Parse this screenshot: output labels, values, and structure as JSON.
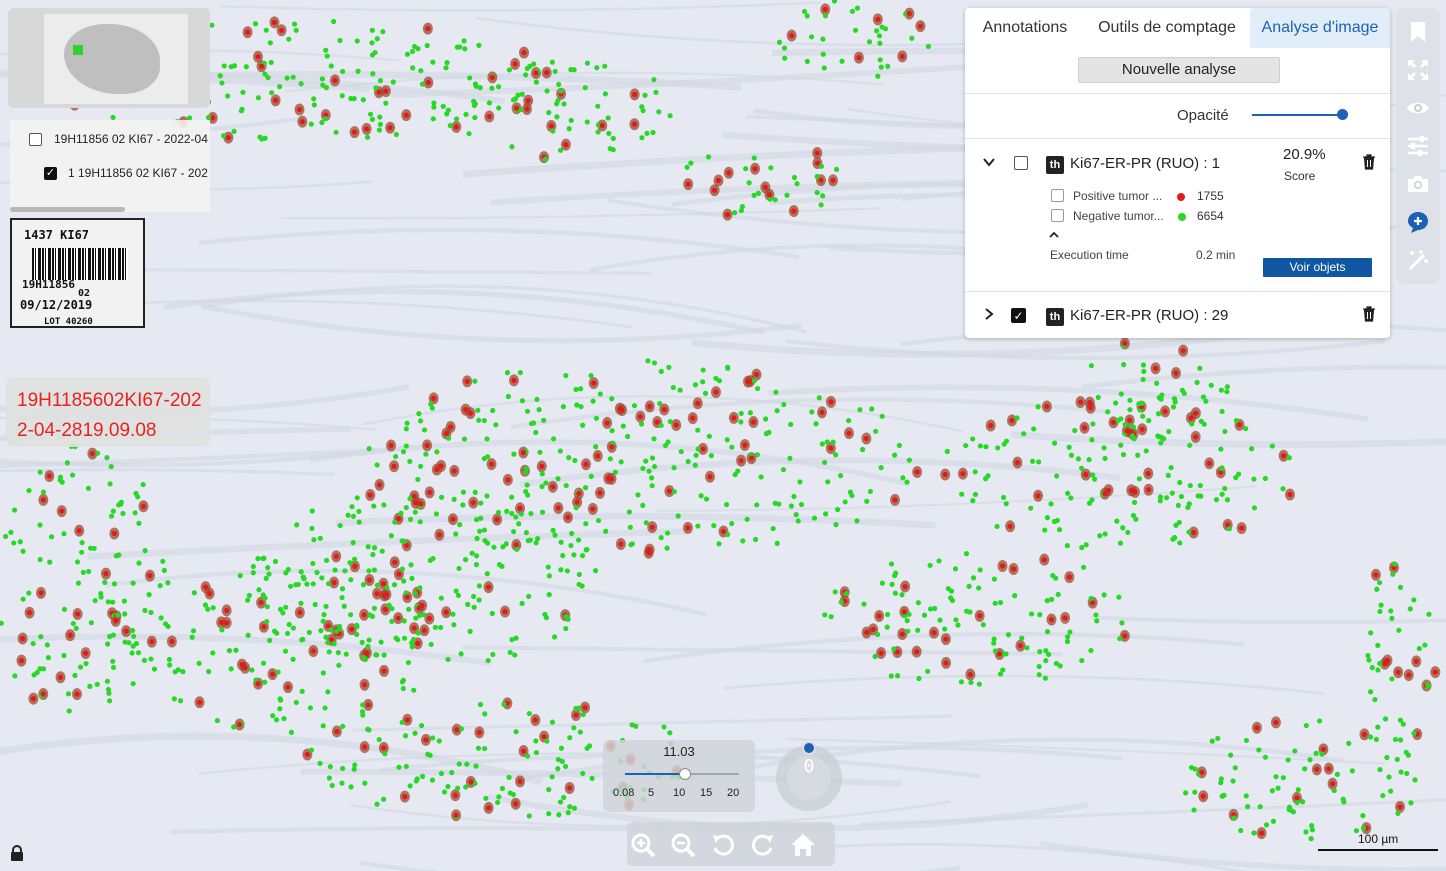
{
  "slide_list": {
    "items": [
      {
        "label": "19H11856 02 KI67 - 2022-04",
        "checked": false
      },
      {
        "label": "1 19H11856 02 KI67 - 202",
        "checked": true
      }
    ]
  },
  "label_image": {
    "line1": "1437 KI67",
    "line2": "19H11856",
    "line3": "02",
    "line4": "09/12/2019",
    "line5": "LOT 40260"
  },
  "slide_name": "19H1185602KI67-2022-04-2819.09.08",
  "panel": {
    "tabs": [
      {
        "label": "Annotations",
        "active": false
      },
      {
        "label": "Outils de comptage",
        "active": false
      },
      {
        "label": "Analyse d'image",
        "active": true
      }
    ],
    "new_analysis_label": "Nouvelle analyse",
    "opacity_label": "Opacité",
    "opacity_value": 0.98,
    "analyses": [
      {
        "title": "Ki67-ER-PR (RUO) : 1",
        "expanded": true,
        "checked": false,
        "score_value": "20.9%",
        "score_label": "Score",
        "classes": [
          {
            "label": "Positive tumor ...",
            "color": "#e5191b",
            "count": "1755"
          },
          {
            "label": "Negative tumor...",
            "color": "#27d827",
            "count": "6654"
          }
        ],
        "execution_label": "Execution time",
        "execution_value": "0.2 min",
        "view_objects_label": "Voir objets"
      },
      {
        "title": "Ki67-ER-PR (RUO) : 29",
        "expanded": false,
        "checked": true
      }
    ]
  },
  "toolbar_icons": [
    "bookmark-icon",
    "fullscreen-icon",
    "eye-icon",
    "sliders-icon",
    "camera-icon",
    "comment-add-icon",
    "magic-wand-icon"
  ],
  "zoom": {
    "value": "11.03",
    "ticks": [
      "0.08",
      "5",
      "10",
      "15",
      "20"
    ]
  },
  "rotation": "0",
  "scalebar_label": "100 µm",
  "colors": {
    "positive": "#e5191b",
    "negative": "#27d827",
    "accent": "#1c61b6"
  }
}
